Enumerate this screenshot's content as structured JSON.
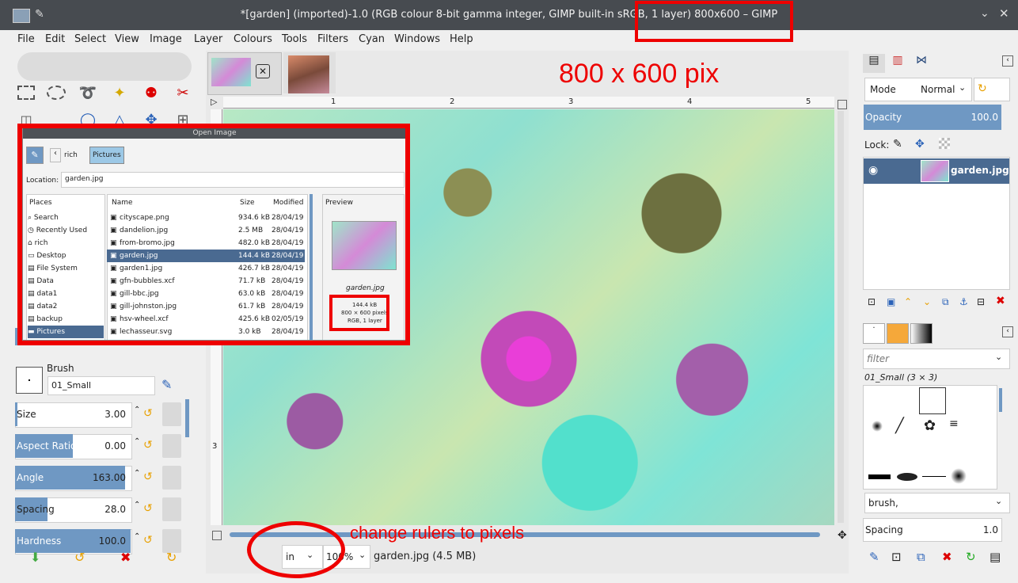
{
  "window": {
    "title": "*[garden] (imported)-1.0 (RGB colour 8-bit gamma integer, GIMP built-in sRGB, 1 layer) 800x600 – GIMP"
  },
  "menu": [
    "File",
    "Edit",
    "Select",
    "View",
    "Image",
    "Layer",
    "Colours",
    "Tools",
    "Filters",
    "Cyan",
    "Windows",
    "Help"
  ],
  "annotations": {
    "size_label": "800 x 600 pix",
    "rulers_hint": "change rulers to pixels"
  },
  "rulers": {
    "h_ticks": [
      "1",
      "2",
      "3",
      "4",
      "5"
    ],
    "v_ticks": [
      "3"
    ]
  },
  "tool_options": {
    "opacity_label": "Opacity",
    "opacity_value": "100.0",
    "brush_label": "Brush",
    "brush_name": "01_Small",
    "sliders": [
      {
        "label": "Size",
        "value": "3.00",
        "fill": 0.02
      },
      {
        "label": "Aspect Ratio",
        "value": "0.00",
        "fill": 0.5
      },
      {
        "label": "Angle",
        "value": "163.00",
        "fill": 0.95
      },
      {
        "label": "Spacing",
        "value": "28.0",
        "fill": 0.28
      },
      {
        "label": "Hardness",
        "value": "100.0",
        "fill": 1.0
      }
    ]
  },
  "dialog": {
    "title": "Open Image",
    "path": [
      "rich",
      "Pictures"
    ],
    "location_label": "Location:",
    "location_value": "garden.jpg",
    "places_header": "Places",
    "places": [
      "Search",
      "Recently Used",
      "rich",
      "Desktop",
      "File System",
      "Data",
      "data1",
      "data2",
      "backup",
      "Pictures"
    ],
    "columns": [
      "Name",
      "Size",
      "Modified"
    ],
    "files": [
      {
        "name": "cityscape.png",
        "size": "934.6 kB",
        "modified": "28/04/19"
      },
      {
        "name": "dandelion.jpg",
        "size": "2.5 MB",
        "modified": "28/04/19"
      },
      {
        "name": "from-bromo.jpg",
        "size": "482.0 kB",
        "modified": "28/04/19"
      },
      {
        "name": "garden.jpg",
        "size": "144.4 kB",
        "modified": "28/04/19"
      },
      {
        "name": "garden1.jpg",
        "size": "426.7 kB",
        "modified": "28/04/19"
      },
      {
        "name": "gfn-bubbles.xcf",
        "size": "71.7 kB",
        "modified": "28/04/19"
      },
      {
        "name": "gill-bbc.jpg",
        "size": "63.0 kB",
        "modified": "28/04/19"
      },
      {
        "name": "gill-johnston.jpg",
        "size": "61.7 kB",
        "modified": "28/04/19"
      },
      {
        "name": "hsv-wheel.xcf",
        "size": "425.6 kB",
        "modified": "02/05/19"
      },
      {
        "name": "lechasseur.svg",
        "size": "3.0 kB",
        "modified": "28/04/19"
      }
    ],
    "preview_header": "Preview",
    "preview_name": "garden.jpg",
    "preview_info": [
      "144.4 kB",
      "800 × 600 pixels",
      "RGB, 1 layer"
    ]
  },
  "status": {
    "unit": "in",
    "zoom": "100%",
    "file": "garden.jpg (4.5 MB)"
  },
  "layers": {
    "mode_label": "Mode",
    "mode_value": "Normal",
    "opacity_label": "Opacity",
    "opacity_value": "100.0",
    "lock_label": "Lock:",
    "layer_name": "garden.jpg"
  },
  "brushes": {
    "filter_placeholder": "filter",
    "brush_title": "01_Small (3 × 3)",
    "tag_value": "brush,",
    "spacing_label": "Spacing",
    "spacing_value": "1.0"
  }
}
